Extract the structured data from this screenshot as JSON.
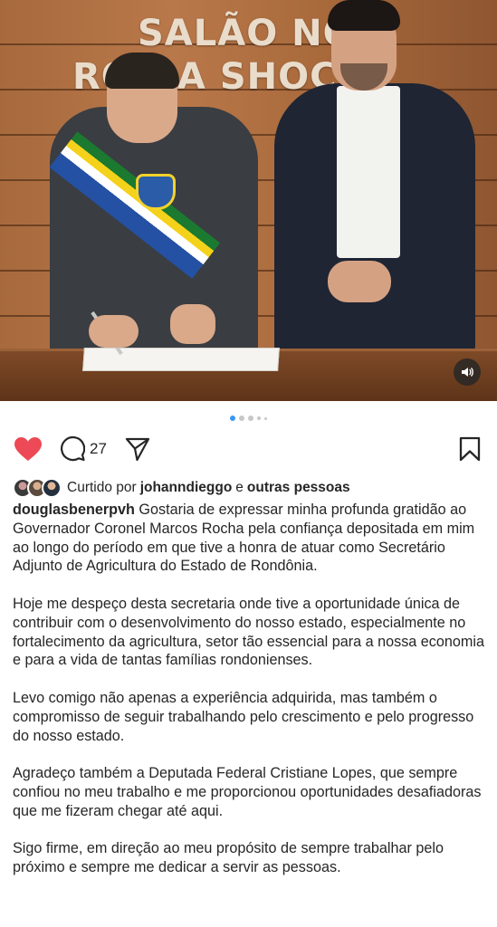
{
  "photo": {
    "sign_line1": "SALÃO NOB",
    "sign_line2": "RO  DA SHOC   S",
    "sound_icon": "speaker-icon",
    "carousel_dots": 5,
    "carousel_active_index": 0
  },
  "actions": {
    "like_icon": "heart-filled-icon",
    "like_color": "#ed4956",
    "comment_icon": "comment-icon",
    "comment_count": "27",
    "share_icon": "send-icon",
    "save_icon": "bookmark-icon"
  },
  "likes": {
    "prefix": "Curtido por",
    "user": "johanndieggo",
    "joiner": "e",
    "others": "outras pessoas"
  },
  "caption": {
    "username": "douglasbenerpvh",
    "paragraph1": "Gostaria de expressar minha profunda gratidão ao Governador Coronel Marcos Rocha pela confiança depositada em mim ao longo do período em que tive a honra de atuar como Secretário Adjunto de Agricultura do Estado de Rondônia.",
    "paragraph2": "Hoje me despeço desta secretaria onde tive a oportunidade única de contribuir com o desenvolvimento do nosso estado, especialmente no fortalecimento da agricultura, setor tão essencial para a nossa economia e para a vida de tantas famílias rondonienses.",
    "paragraph3": "Levo comigo não apenas a experiência adquirida, mas também o compromisso de seguir trabalhando pelo crescimento e pelo progresso do nosso estado.",
    "paragraph4": "Agradeço também a Deputada Federal Cristiane Lopes, que sempre confiou no meu trabalho e me proporcionou oportunidades desafiadoras que me fizeram chegar até aqui.",
    "paragraph5": "Sigo firme, em direção ao meu propósito de sempre trabalhar pelo próximo e sempre me dedicar a servir as pessoas."
  }
}
